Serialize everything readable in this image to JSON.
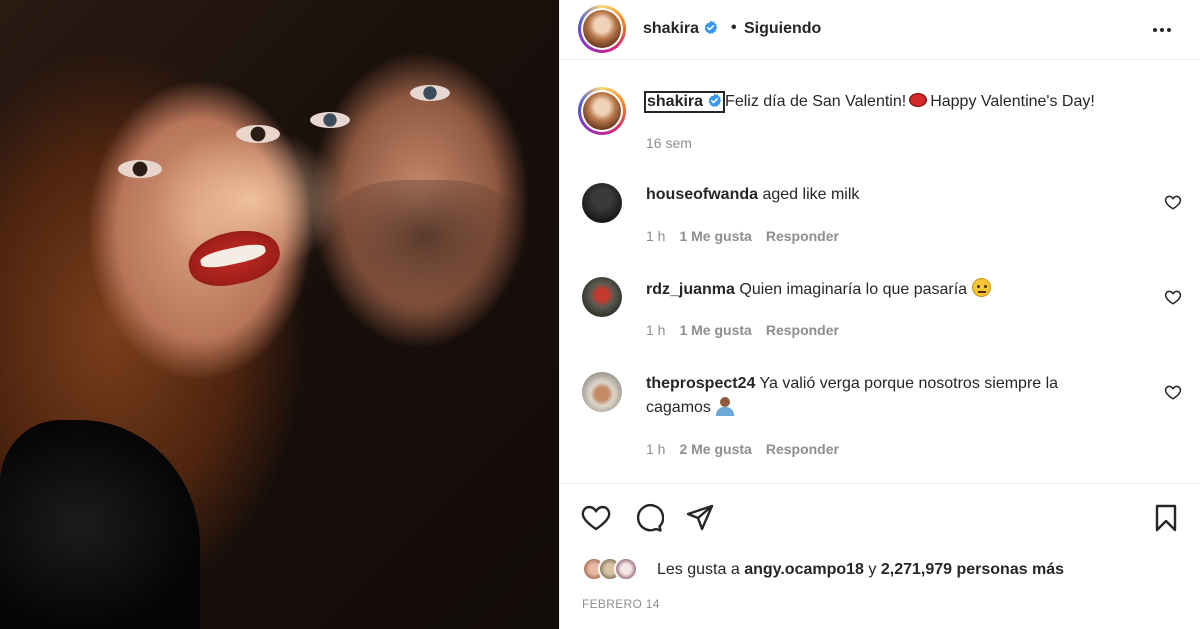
{
  "post": {
    "username": "shakira",
    "follow_status": "Siguiendo",
    "separator": "•"
  },
  "caption": {
    "username": "shakira",
    "text_part1": "Feliz día de San Valentin!",
    "text_part2": "Happy Valentine's Day!",
    "time": "16 sem"
  },
  "comments": [
    {
      "username": "houseofwanda",
      "text": "aged like milk",
      "time": "1 h",
      "likes": "1 Me gusta",
      "reply": "Responder"
    },
    {
      "username": "rdz_juanma",
      "text": "Quien imaginaría lo que pasaría",
      "time": "1 h",
      "likes": "1 Me gusta",
      "reply": "Responder"
    },
    {
      "username": "theprospect24",
      "text": "Ya valió verga porque nosotros siempre la cagamos",
      "time": "1 h",
      "likes": "2 Me gusta",
      "reply": "Responder"
    }
  ],
  "likes": {
    "prefix": "Les gusta a",
    "user": "angy.ocampo18",
    "joiner": "y",
    "count": "2,271,979 personas más"
  },
  "date": "FEBRERO 14",
  "icons": {
    "like": "heart-icon",
    "comment": "comment-icon",
    "share": "send-icon",
    "save": "bookmark-icon",
    "more": "more-options-icon",
    "verified": "verified-badge-icon"
  },
  "colors": {
    "verified": "#3897f0",
    "text": "#262626",
    "muted": "#8e8e8e",
    "border": "#efefef"
  }
}
